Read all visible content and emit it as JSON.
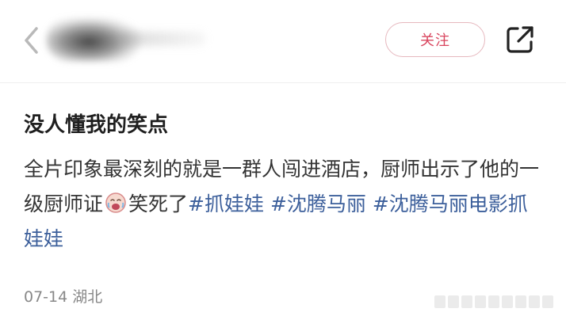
{
  "header": {
    "follow_label": "关注",
    "icons": {
      "back": "chevron-left-icon",
      "share": "share-external-icon"
    }
  },
  "post": {
    "title": "没人懂我的笑点",
    "body_part1": "全片印象最深刻的就是一群人闯进酒店，厨师出示了他的一级厨师证",
    "emoji": "laughing-crying-emoji",
    "body_part2": "笑死了",
    "hashtags": [
      "#抓娃娃",
      "#沈腾马丽",
      "#沈腾马丽电影抓娃娃"
    ]
  },
  "meta": {
    "date": "07-14",
    "location": "湖北"
  },
  "colors": {
    "follow": "#d9455e",
    "hashtag": "#3c5f9b",
    "meta": "#888888"
  }
}
